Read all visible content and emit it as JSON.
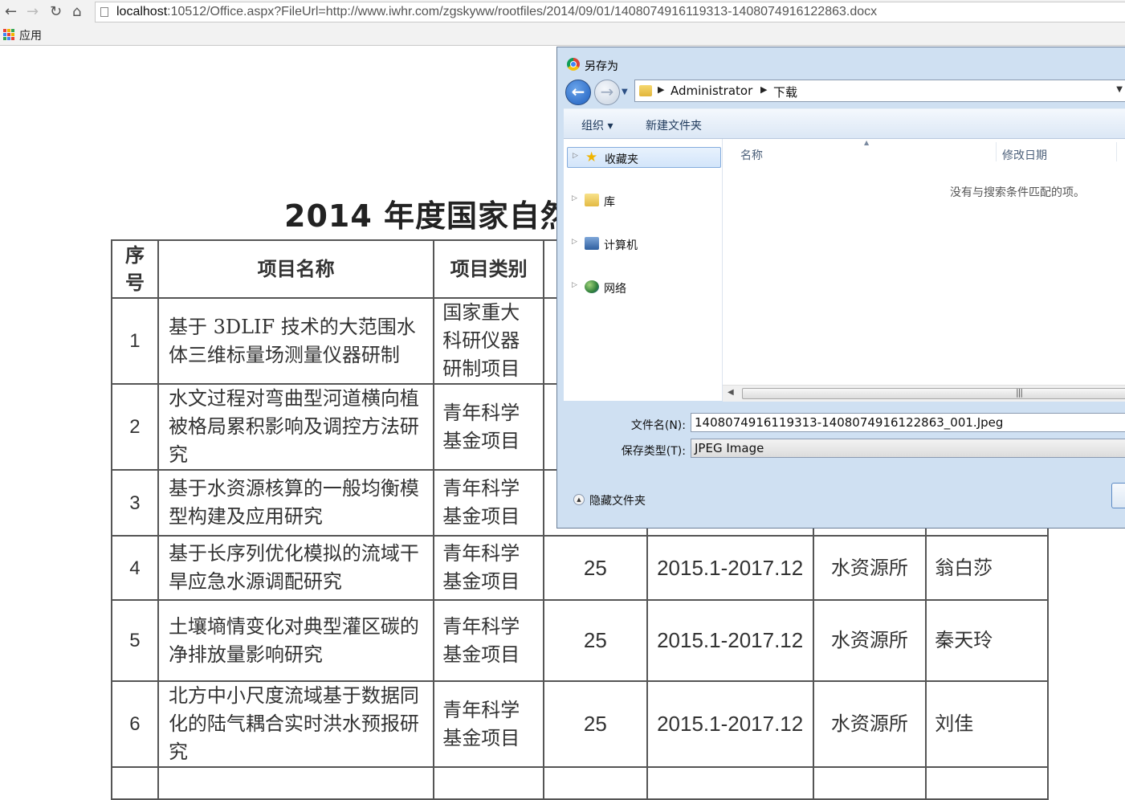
{
  "browser": {
    "back_icon": "back-arrow-icon",
    "forward_icon": "forward-arrow-icon",
    "reload_icon": "reload-icon",
    "home_icon": "home-icon",
    "url_host": "localhost",
    "url_rest": ":10512/Office.aspx?FileUrl=http://www.iwhr.com/zgskyww/rootfiles/2014/09/01/1408074916119313-1408074916122863.docx",
    "apps_label": "应用"
  },
  "document": {
    "title": "2014 年度国家自然",
    "headers": [
      "序号",
      "项目名称",
      "项目类别"
    ],
    "rows": [
      {
        "no": "1",
        "name": "基于 3DLIF 技术的大范围水体三维标量场测量仪器研制",
        "category": "国家重大科研仪器研制项目"
      },
      {
        "no": "2",
        "name": "水文过程对弯曲型河道横向植被格局累积影响及调控方法研究",
        "category": "青年科学基金项目"
      },
      {
        "no": "3",
        "name": "基于水资源核算的一般均衡模型构建及应用研究",
        "category": "青年科学基金项目"
      },
      {
        "no": "4",
        "name": "基于长序列优化模拟的流域干旱应急水源调配研究",
        "category": "青年科学基金项目",
        "amount": "25",
        "period": "2015.1-2017.12",
        "dept": "水资源所",
        "person": "翁白莎"
      },
      {
        "no": "5",
        "name": "土壤墒情变化对典型灌区碳的净排放量影响研究",
        "category": "青年科学基金项目",
        "amount": "25",
        "period": "2015.1-2017.12",
        "dept": "水资源所",
        "person": "秦天玲"
      },
      {
        "no": "6",
        "name": "北方中小尺度流域基于数据同化的陆气耦合实时洪水预报研究",
        "category": "青年科学基金项目",
        "amount": "25",
        "period": "2015.1-2017.12",
        "dept": "水资源所",
        "person": "刘佳"
      }
    ]
  },
  "dialog": {
    "title": "另存为",
    "breadcrumb": [
      "Administrator",
      "下载"
    ],
    "toolbar": {
      "organize": "组织 ▾",
      "new_folder": "新建文件夹"
    },
    "nav": {
      "favorites": "收藏夹",
      "libraries": "库",
      "computer": "计算机",
      "network": "网络"
    },
    "columns": {
      "name": "名称",
      "modified": "修改日期"
    },
    "empty_message": "没有与搜索条件匹配的项。",
    "filename_label": "文件名(N):",
    "filename_value": "1408074916119313-1408074916122863_001.Jpeg",
    "filetype_label": "保存类型(T):",
    "filetype_value": "JPEG Image",
    "hide_folders": "隐藏文件夹"
  }
}
